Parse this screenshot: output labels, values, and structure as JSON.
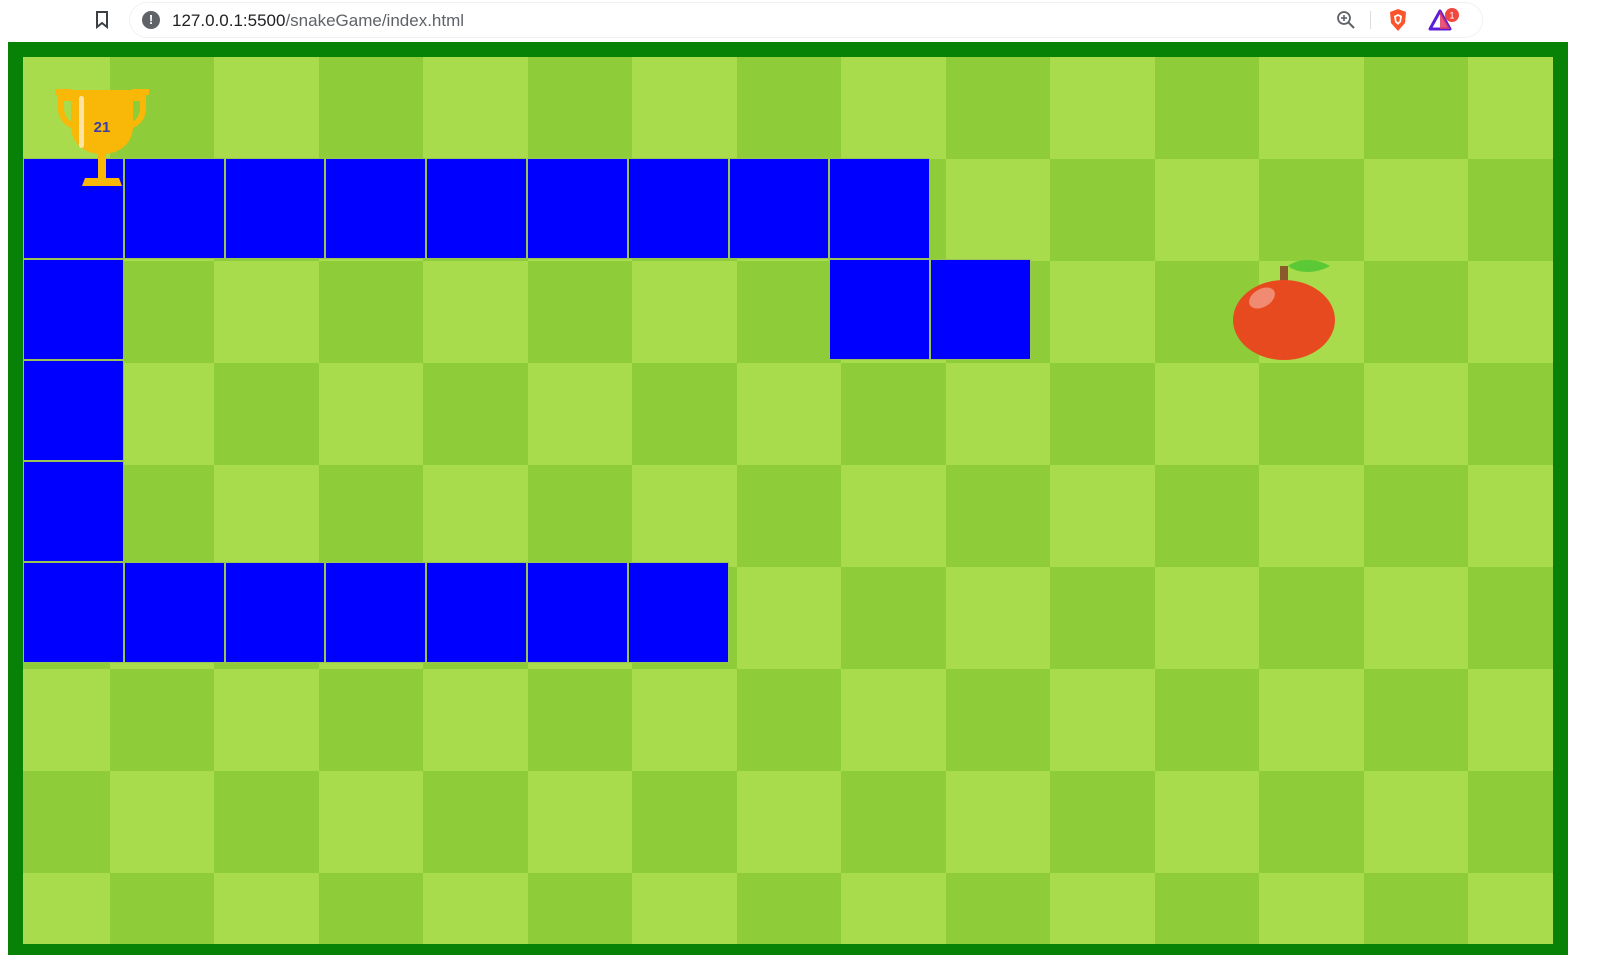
{
  "browser": {
    "url_host": "127.0.0.1:5500",
    "url_path": "/snakeGame/index.html",
    "icons": {
      "bookmark": "bookmark-icon",
      "site_info": "info-icon",
      "zoom": "zoom-icon",
      "brave": "brave-shield-icon",
      "rewards": "brave-rewards-icon"
    },
    "rewards_badge": "1"
  },
  "game": {
    "score": "21",
    "colors": {
      "frame": "#078207",
      "tile_light": "#a9dc4d",
      "tile_dark": "#8ecd39",
      "snake": "#0000ff",
      "apple": "#e84a1f",
      "trophy": "#f9b708"
    },
    "grid": {
      "columns": 15,
      "rows": 9
    },
    "snake_cells": [
      [
        8,
        2
      ],
      [
        9,
        2
      ],
      [
        8,
        1
      ],
      [
        7,
        1
      ],
      [
        6,
        1
      ],
      [
        5,
        1
      ],
      [
        4,
        1
      ],
      [
        3,
        1
      ],
      [
        2,
        1
      ],
      [
        1,
        1
      ],
      [
        0,
        1
      ],
      [
        0,
        2
      ],
      [
        0,
        3
      ],
      [
        0,
        4
      ],
      [
        0,
        5
      ],
      [
        1,
        5
      ],
      [
        2,
        5
      ],
      [
        3,
        5
      ],
      [
        4,
        5
      ],
      [
        5,
        5
      ],
      [
        6,
        5
      ]
    ],
    "apple_cell": [
      12,
      2
    ]
  }
}
